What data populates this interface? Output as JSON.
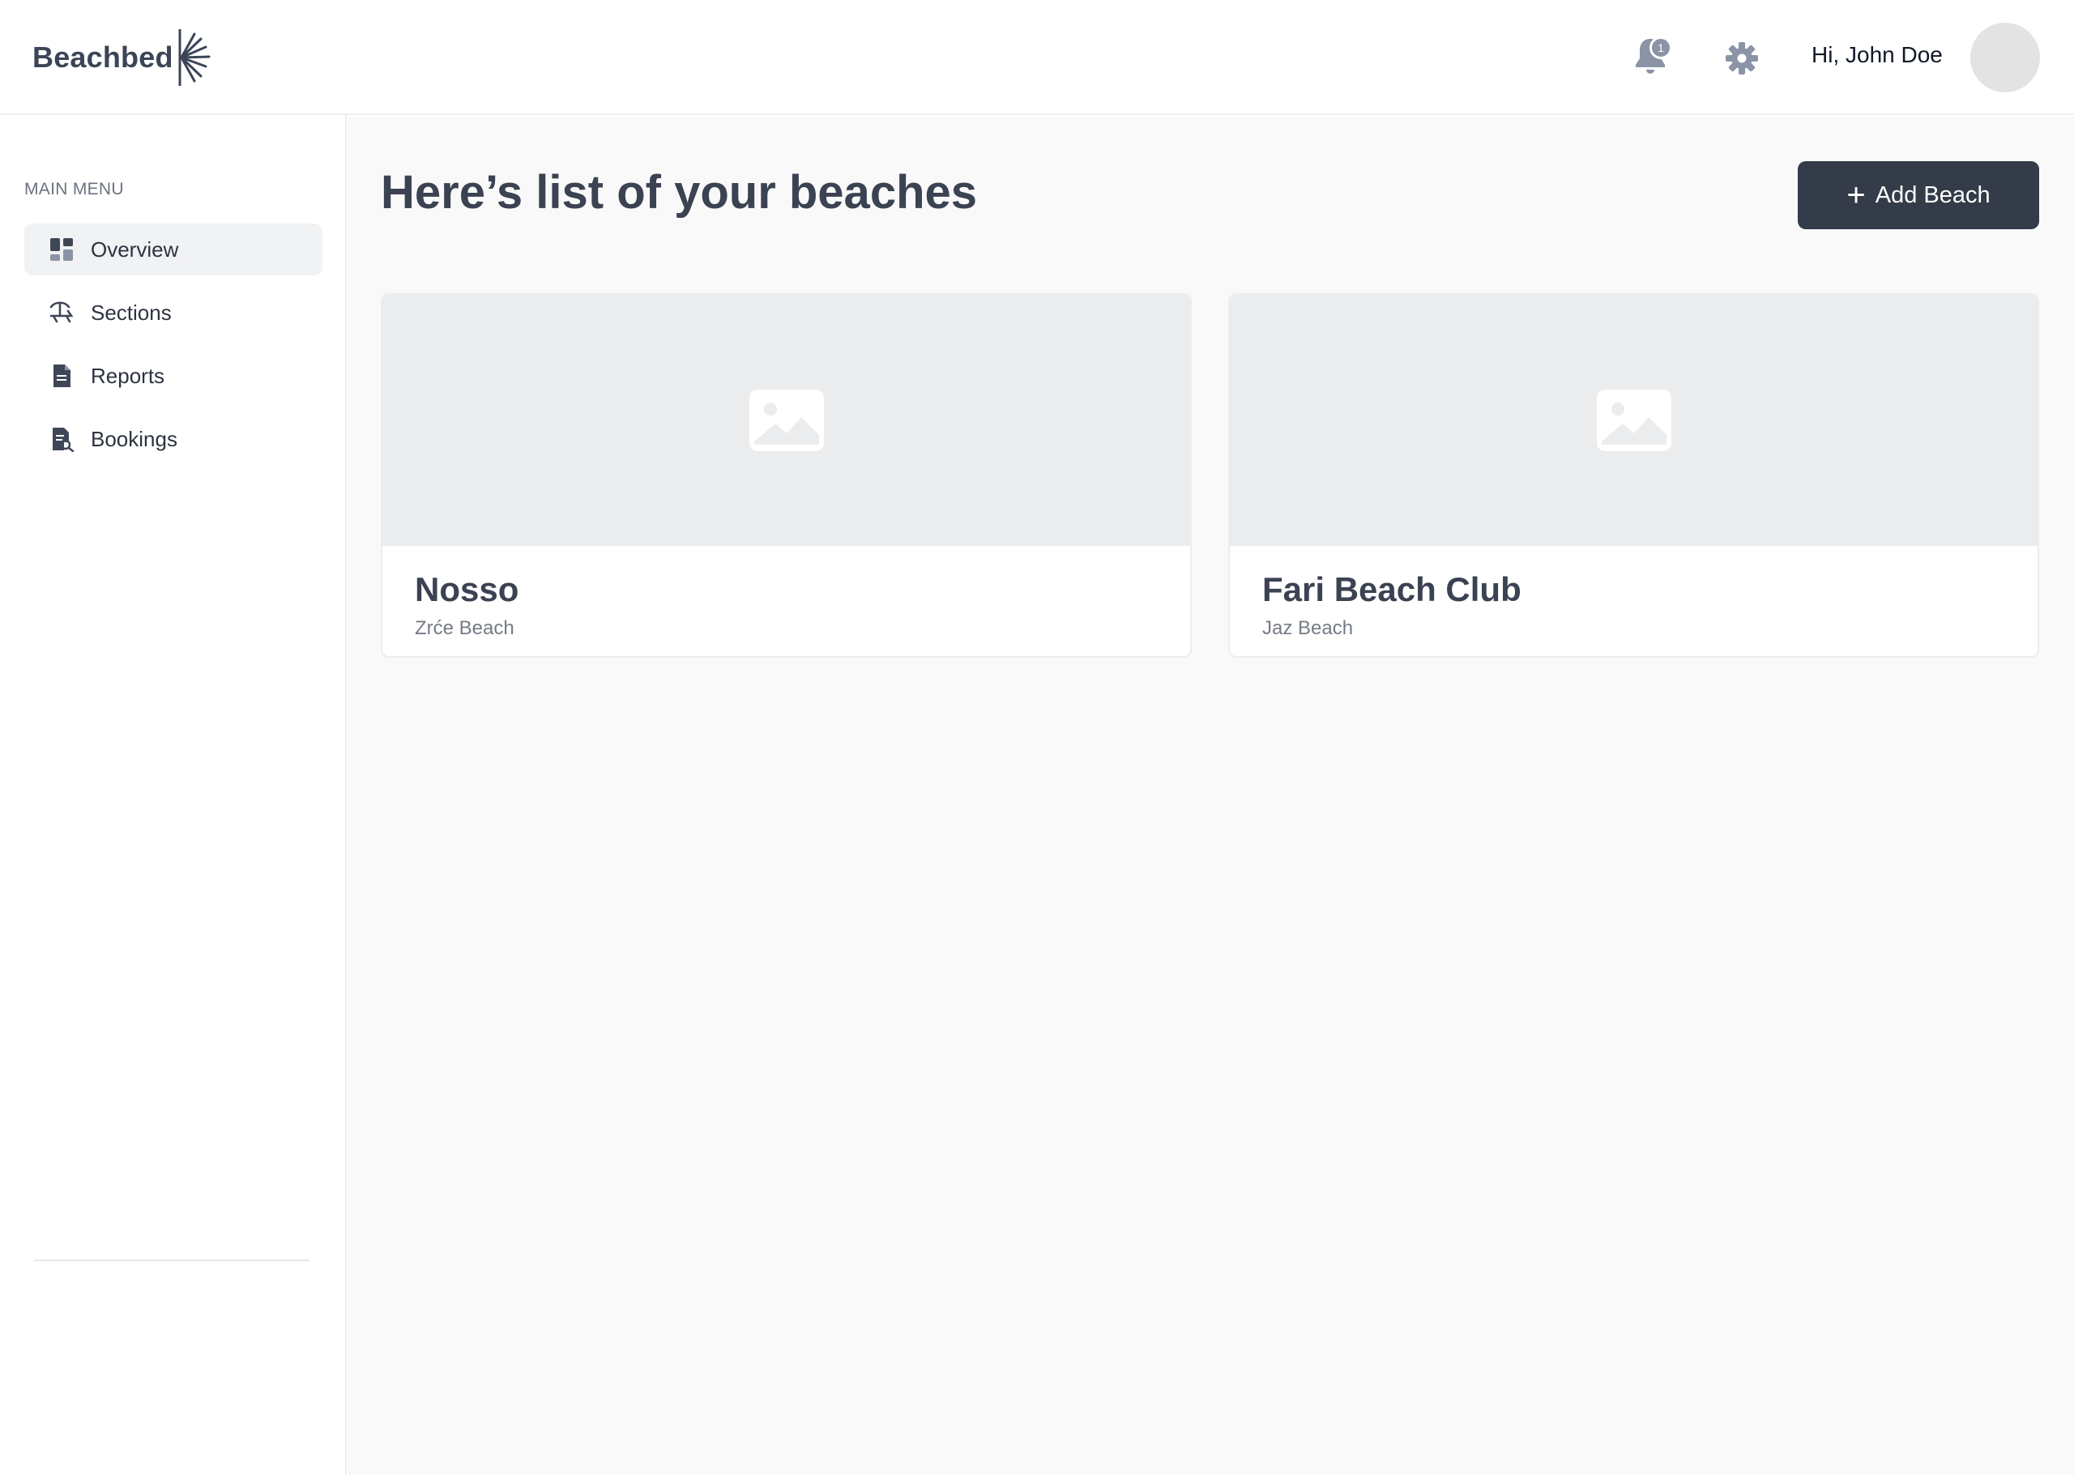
{
  "header": {
    "logo_text": "Beachbed",
    "notification_count": "1",
    "greeting": "Hi, John Doe"
  },
  "sidebar": {
    "heading": "MAIN MENU",
    "items": [
      {
        "label": "Overview",
        "icon": "dashboard-icon",
        "active": true
      },
      {
        "label": "Sections",
        "icon": "beach-chair-icon",
        "active": false
      },
      {
        "label": "Reports",
        "icon": "document-icon",
        "active": false
      },
      {
        "label": "Bookings",
        "icon": "booking-document-icon",
        "active": false
      }
    ]
  },
  "main": {
    "title": "Here’s list of your beaches",
    "add_button_label": "Add Beach",
    "beaches": [
      {
        "name": "Nosso",
        "location": "Zrće Beach",
        "image_icon": "image-placeholder-icon"
      },
      {
        "name": "Fari Beach Club",
        "location": "Jaz Beach",
        "image_icon": "image-placeholder-icon"
      }
    ]
  },
  "colors": {
    "primary_dark": "#343b49",
    "text_dark": "#3b4252",
    "muted": "#757b86",
    "placeholder_bg": "#ebecee",
    "page_bg": "#f9f9f9"
  }
}
